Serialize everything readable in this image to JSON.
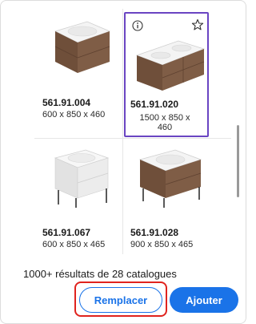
{
  "products": [
    {
      "code": "561.91.004",
      "dims": "600 x  850 x  460",
      "finish": "wood",
      "selected": false
    },
    {
      "code": "561.91.020",
      "dims": "1500 x  850 x\n460",
      "finish": "wood",
      "selected": true
    },
    {
      "code": "561.91.067",
      "dims": "600 x  850 x  465",
      "finish": "white",
      "selected": false
    },
    {
      "code": "561.91.028",
      "dims": "900 x  850 x  465",
      "finish": "wood",
      "selected": false
    }
  ],
  "results_text": "1000+ résultats de 28 catalogues",
  "buttons": {
    "replace_label": "Remplacer",
    "add_label": "Ajouter"
  },
  "colors": {
    "accent": "#1a73e8",
    "selection": "#6a45c2",
    "highlight": "#e0231e",
    "wood": "#7a5a45",
    "white_cabinet": "#e8e8e8"
  }
}
